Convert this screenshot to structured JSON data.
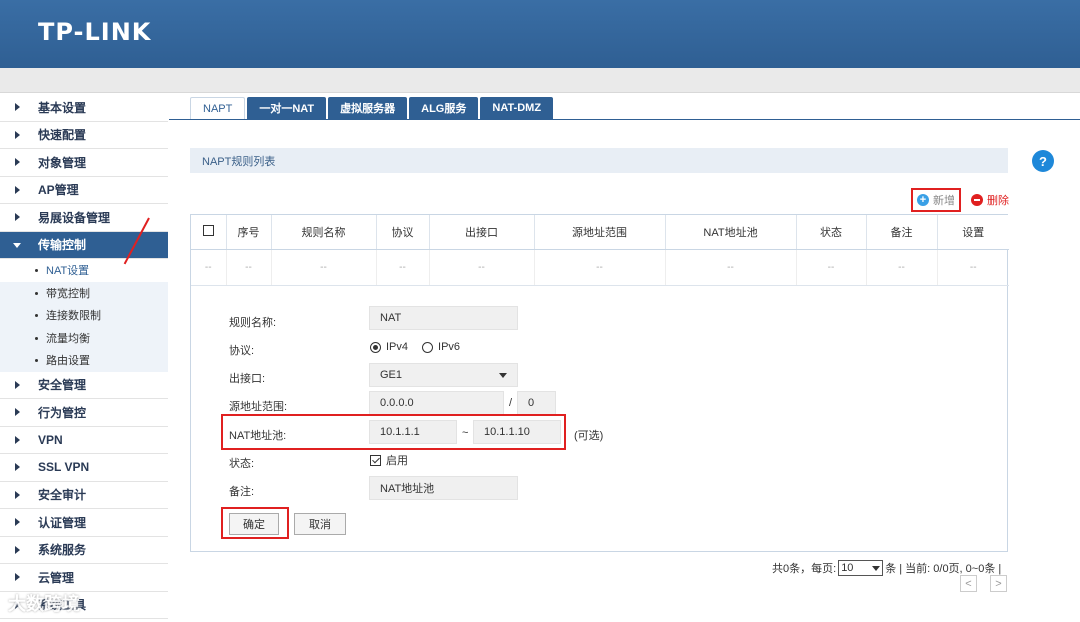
{
  "brand": "TP-LINK",
  "sidebar": {
    "items": [
      {
        "label": "基本设置"
      },
      {
        "label": "快速配置"
      },
      {
        "label": "对象管理"
      },
      {
        "label": "AP管理"
      },
      {
        "label": "易展设备管理"
      },
      {
        "label": "传输控制"
      }
    ],
    "sub_items": [
      {
        "label": "NAT设置"
      },
      {
        "label": "带宽控制"
      },
      {
        "label": "连接数限制"
      },
      {
        "label": "流量均衡"
      },
      {
        "label": "路由设置"
      }
    ],
    "items_after": [
      {
        "label": "安全管理"
      },
      {
        "label": "行为管控"
      },
      {
        "label": "VPN"
      },
      {
        "label": "SSL VPN"
      },
      {
        "label": "安全审计"
      },
      {
        "label": "认证管理"
      },
      {
        "label": "系统服务"
      },
      {
        "label": "云管理"
      },
      {
        "label": "系统工具"
      }
    ]
  },
  "tabs": [
    {
      "label": "NAPT"
    },
    {
      "label": "一对一NAT"
    },
    {
      "label": "虚拟服务器"
    },
    {
      "label": "ALG服务"
    },
    {
      "label": "NAT-DMZ"
    }
  ],
  "section_title": "NAPT规则列表",
  "help_label": "?",
  "actions": {
    "new_label": "新增",
    "delete_label": "删除"
  },
  "table": {
    "headers": [
      "序号",
      "规则名称",
      "协议",
      "出接口",
      "源地址范围",
      "NAT地址池",
      "状态",
      "备注",
      "设置"
    ],
    "empty_cell": "--"
  },
  "form": {
    "rule_name_label": "规则名称:",
    "rule_name_value": "NAT",
    "protocol_label": "协议:",
    "ipv4_label": "IPv4",
    "ipv6_label": "IPv6",
    "protocol_selected": "IPv4",
    "interface_label": "出接口:",
    "interface_value": "GE1",
    "src_label": "源地址范围:",
    "src_ip": "0.0.0.0",
    "src_sep": "/",
    "src_mask": "0",
    "pool_label": "NAT地址池:",
    "pool_start": "10.1.1.1",
    "pool_sep": "~",
    "pool_end": "10.1.1.10",
    "pool_optional": "(可选)",
    "status_label": "状态:",
    "status_enable_label": "启用",
    "status_enabled": true,
    "note_label": "备注:",
    "note_value": "NAT地址池",
    "confirm_label": "确定",
    "cancel_label": "取消"
  },
  "pager": {
    "total_text": "共0条，每页:",
    "per_page": "10",
    "suffix_text": "条 | 当前: 0/0页, 0~0条 |",
    "prev": "<",
    "next": ">"
  },
  "watermark": "大数跨境",
  "colors": {
    "brand_blue": "#2f5f93",
    "highlight_red": "#e02020",
    "help_blue": "#1e88d9"
  }
}
